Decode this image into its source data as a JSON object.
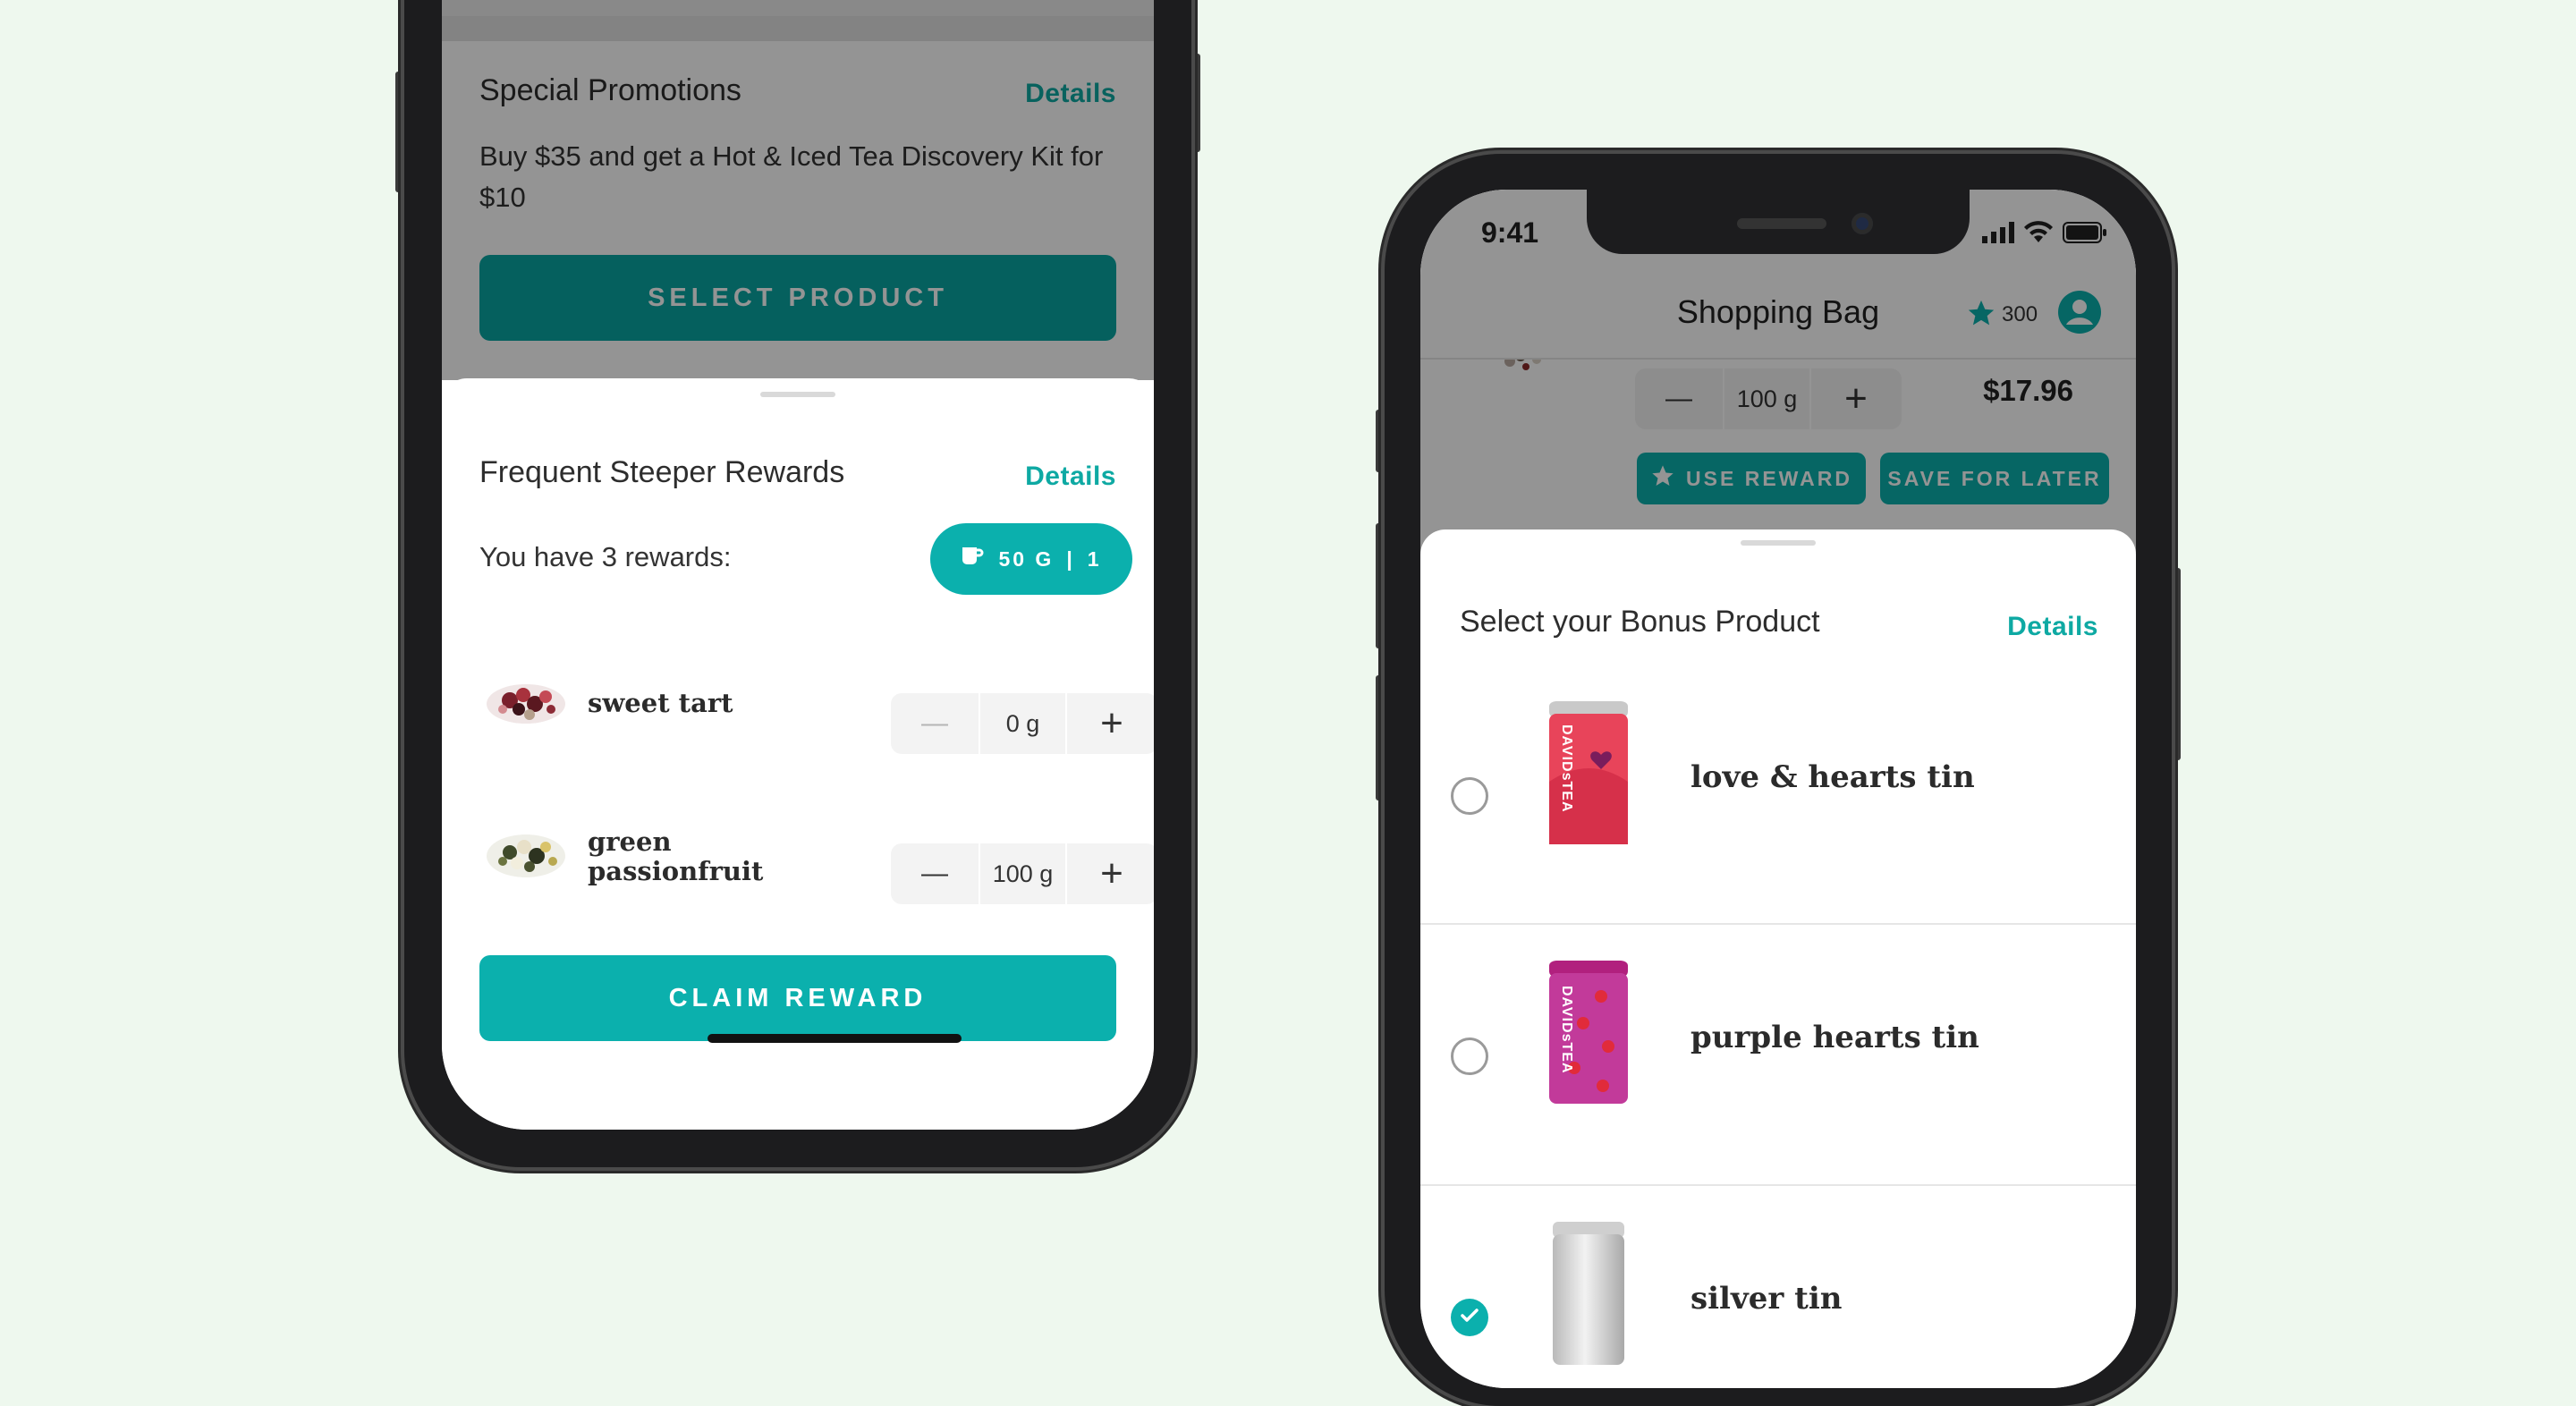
{
  "colors": {
    "background": "#eef8ee",
    "accent": "#0bb0ad",
    "link": "#0ea9a3"
  },
  "left_phone": {
    "promo": {
      "title": "Special Promotions",
      "details_label": "Details",
      "description": "Buy $35 and get a Hot & Iced Tea Discovery Kit for $10",
      "button_label": "SELECT PRODUCT"
    },
    "rewards_sheet": {
      "title": "Frequent Steeper Rewards",
      "details_label": "Details",
      "count_text": "You have 3 rewards:",
      "chip": {
        "icon": "cup-icon",
        "size": "50 G",
        "separator": "|",
        "count": "1"
      },
      "items": [
        {
          "name": "sweet tart",
          "quantity": "0 g",
          "minus": "—",
          "plus": "+"
        },
        {
          "name_line1": "green",
          "name_line2": "passionfruit",
          "quantity": "100 g",
          "minus": "—",
          "plus": "+"
        }
      ],
      "claim_label": "CLAIM REWARD"
    }
  },
  "right_phone": {
    "status": {
      "time": "9:41"
    },
    "header": {
      "title": "Shopping Bag",
      "points": "300",
      "star_icon": "star-icon",
      "account_icon": "account-icon"
    },
    "bag_item": {
      "quantity": "100 g",
      "minus": "—",
      "plus": "+",
      "price": "$17.96"
    },
    "actions": {
      "use_reward": "USE REWARD",
      "save_for_later": "SAVE FOR LATER"
    },
    "bonus_sheet": {
      "title": "Select your Bonus Product",
      "details_label": "Details",
      "options": [
        {
          "name": "love & hearts tin",
          "selected": false,
          "tin_label": "DAVIDsTEA"
        },
        {
          "name": "purple hearts tin",
          "selected": false,
          "tin_label": "DAVIDsTEA"
        },
        {
          "name": "silver tin",
          "selected": true,
          "tin_label": ""
        }
      ]
    }
  }
}
